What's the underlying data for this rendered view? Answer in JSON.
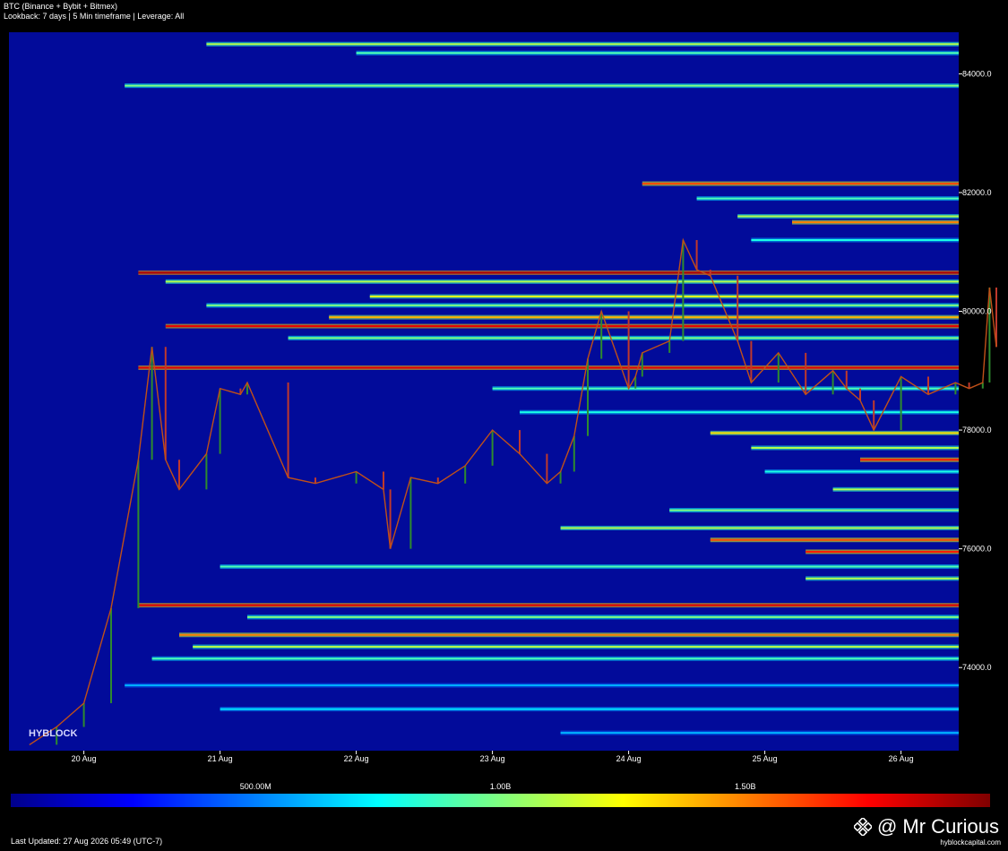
{
  "header": {
    "title": "BTC (Binance + Bybit + Bitmex)",
    "subtitle": "Lookback: 7 days | 5 Min timeframe | Leverage: All"
  },
  "footer": {
    "last_updated": "Last Updated: 27 Aug 2026 05:49 (UTC-7)",
    "site": "hyblockcapital.com",
    "watermark": "@ Mr Curious"
  },
  "logo": "HYBLOCK",
  "chart_data": {
    "type": "heatmap",
    "title": "BTC (Binance + Bybit + Bitmex)",
    "x_ticks": [
      "20 Aug",
      "21 Aug",
      "22 Aug",
      "23 Aug",
      "24 Aug",
      "25 Aug",
      "26 Aug"
    ],
    "y_ticks": [
      "74000.0",
      "76000.0",
      "78000.0",
      "80000.0",
      "82000.0",
      "84000.0"
    ],
    "ylim": [
      72600,
      84700
    ],
    "colorbar": {
      "ticks": [
        "500.00M",
        "1.00B",
        "1.50B"
      ],
      "range": [
        0,
        2000000000
      ],
      "colormap": "jet"
    },
    "price_series": {
      "x_day": [
        19.6,
        19.8,
        20.0,
        20.2,
        20.4,
        20.5,
        20.6,
        20.7,
        20.9,
        21.0,
        21.15,
        21.2,
        21.5,
        21.7,
        22.0,
        22.2,
        22.25,
        22.4,
        22.6,
        22.8,
        23.0,
        23.2,
        23.4,
        23.5,
        23.6,
        23.7,
        23.8,
        24.0,
        24.05,
        24.1,
        24.3,
        24.4,
        24.5,
        24.6,
        24.8,
        24.9,
        25.1,
        25.3,
        25.5,
        25.6,
        25.7,
        25.8,
        26.0,
        26.2,
        26.4,
        26.5,
        26.6,
        26.65,
        26.7
      ],
      "price": [
        72700,
        73000,
        73400,
        75000,
        77500,
        79400,
        77500,
        77000,
        77600,
        78700,
        78600,
        78800,
        77200,
        77100,
        77300,
        77000,
        76000,
        77200,
        77100,
        77400,
        78000,
        77600,
        77100,
        77300,
        77900,
        79200,
        80000,
        78700,
        78900,
        79300,
        79500,
        81200,
        80700,
        80600,
        79500,
        78800,
        79300,
        78600,
        79000,
        78700,
        78500,
        78000,
        78900,
        78600,
        78800,
        78700,
        78800,
        80400,
        79400
      ]
    },
    "liquidity_bands": [
      {
        "price": 84500,
        "from_day": 20.9,
        "intensity": 0.55
      },
      {
        "price": 84350,
        "from_day": 22.0,
        "intensity": 0.45
      },
      {
        "price": 83800,
        "from_day": 20.3,
        "intensity": 0.5
      },
      {
        "price": 82150,
        "from_day": 24.1,
        "intensity": 0.8
      },
      {
        "price": 81900,
        "from_day": 24.5,
        "intensity": 0.45
      },
      {
        "price": 81600,
        "from_day": 24.8,
        "intensity": 0.55
      },
      {
        "price": 81500,
        "from_day": 25.2,
        "intensity": 0.75
      },
      {
        "price": 81200,
        "from_day": 24.9,
        "intensity": 0.4
      },
      {
        "price": 80650,
        "from_day": 20.4,
        "intensity": 0.95
      },
      {
        "price": 80500,
        "from_day": 20.6,
        "intensity": 0.55
      },
      {
        "price": 80250,
        "from_day": 22.1,
        "intensity": 0.6
      },
      {
        "price": 80100,
        "from_day": 20.9,
        "intensity": 0.5
      },
      {
        "price": 79900,
        "from_day": 21.8,
        "intensity": 0.7
      },
      {
        "price": 79750,
        "from_day": 20.6,
        "intensity": 0.9
      },
      {
        "price": 79550,
        "from_day": 21.5,
        "intensity": 0.5
      },
      {
        "price": 79050,
        "from_day": 20.4,
        "intensity": 0.9
      },
      {
        "price": 78700,
        "from_day": 23.0,
        "intensity": 0.45
      },
      {
        "price": 78300,
        "from_day": 23.2,
        "intensity": 0.4
      },
      {
        "price": 77950,
        "from_day": 24.6,
        "intensity": 0.65
      },
      {
        "price": 77700,
        "from_day": 24.9,
        "intensity": 0.55
      },
      {
        "price": 77500,
        "from_day": 25.7,
        "intensity": 0.85
      },
      {
        "price": 77300,
        "from_day": 25.0,
        "intensity": 0.4
      },
      {
        "price": 77000,
        "from_day": 25.5,
        "intensity": 0.55
      },
      {
        "price": 76650,
        "from_day": 24.3,
        "intensity": 0.5
      },
      {
        "price": 76350,
        "from_day": 23.5,
        "intensity": 0.55
      },
      {
        "price": 76150,
        "from_day": 24.6,
        "intensity": 0.8
      },
      {
        "price": 75950,
        "from_day": 25.3,
        "intensity": 0.85
      },
      {
        "price": 75700,
        "from_day": 21.0,
        "intensity": 0.45
      },
      {
        "price": 75500,
        "from_day": 25.3,
        "intensity": 0.55
      },
      {
        "price": 75050,
        "from_day": 20.4,
        "intensity": 0.9
      },
      {
        "price": 74850,
        "from_day": 21.2,
        "intensity": 0.5
      },
      {
        "price": 74550,
        "from_day": 20.7,
        "intensity": 0.75
      },
      {
        "price": 74350,
        "from_day": 20.8,
        "intensity": 0.55
      },
      {
        "price": 74150,
        "from_day": 20.5,
        "intensity": 0.45
      },
      {
        "price": 73700,
        "from_day": 20.3,
        "intensity": 0.3
      },
      {
        "price": 73300,
        "from_day": 21.0,
        "intensity": 0.35
      },
      {
        "price": 72900,
        "from_day": 23.5,
        "intensity": 0.3
      }
    ]
  }
}
